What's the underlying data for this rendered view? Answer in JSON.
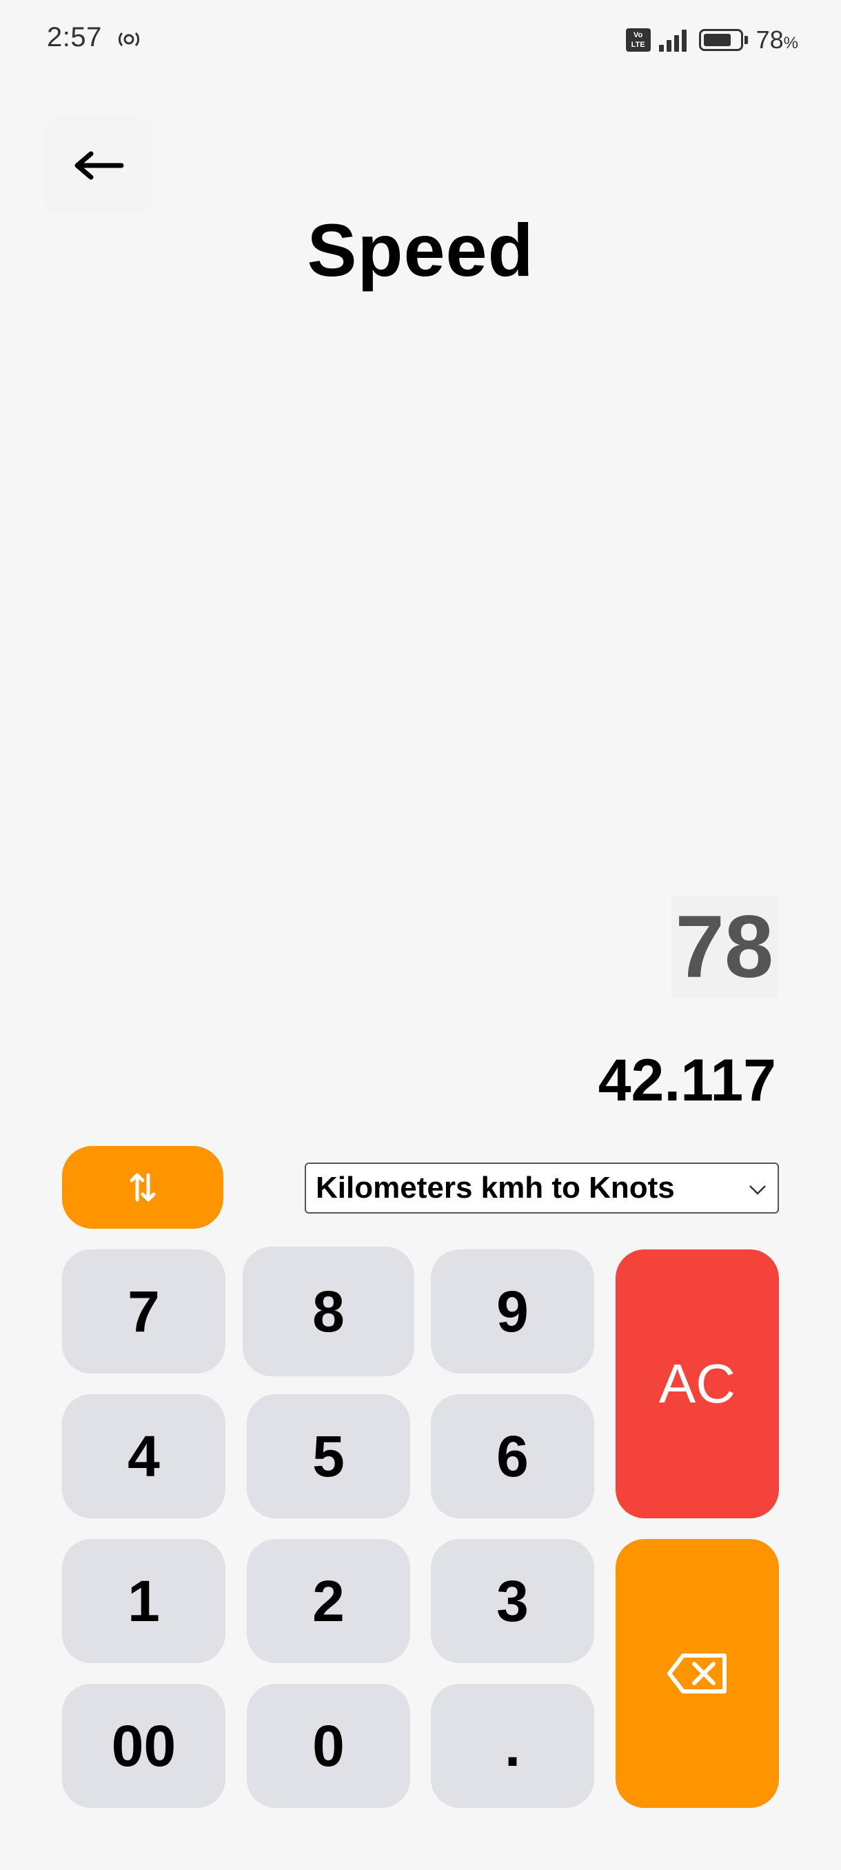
{
  "status_bar": {
    "time": "2:57",
    "volte_label": "Vo LTE",
    "battery_percent": "78",
    "battery_percent_sign": "%",
    "battery_level": 0.78
  },
  "header": {
    "title": "Speed",
    "back_icon": "arrow-left-icon"
  },
  "display": {
    "input_value": "78",
    "result_value": "42.117"
  },
  "controls": {
    "swap_icon": "swap-vertical-icon",
    "conversion_selected": "Kilometers kmh to Knots"
  },
  "keypad": {
    "keys": [
      "7",
      "8",
      "9",
      "4",
      "5",
      "6",
      "1",
      "2",
      "3",
      "00",
      "0",
      "."
    ],
    "clear_label": "AC",
    "backspace_icon": "backspace-icon"
  },
  "colors": {
    "accent_orange": "#fe9400",
    "clear_red": "#f4433a",
    "key_gray": "#e0e1e6",
    "background": "#f6f6f6"
  }
}
